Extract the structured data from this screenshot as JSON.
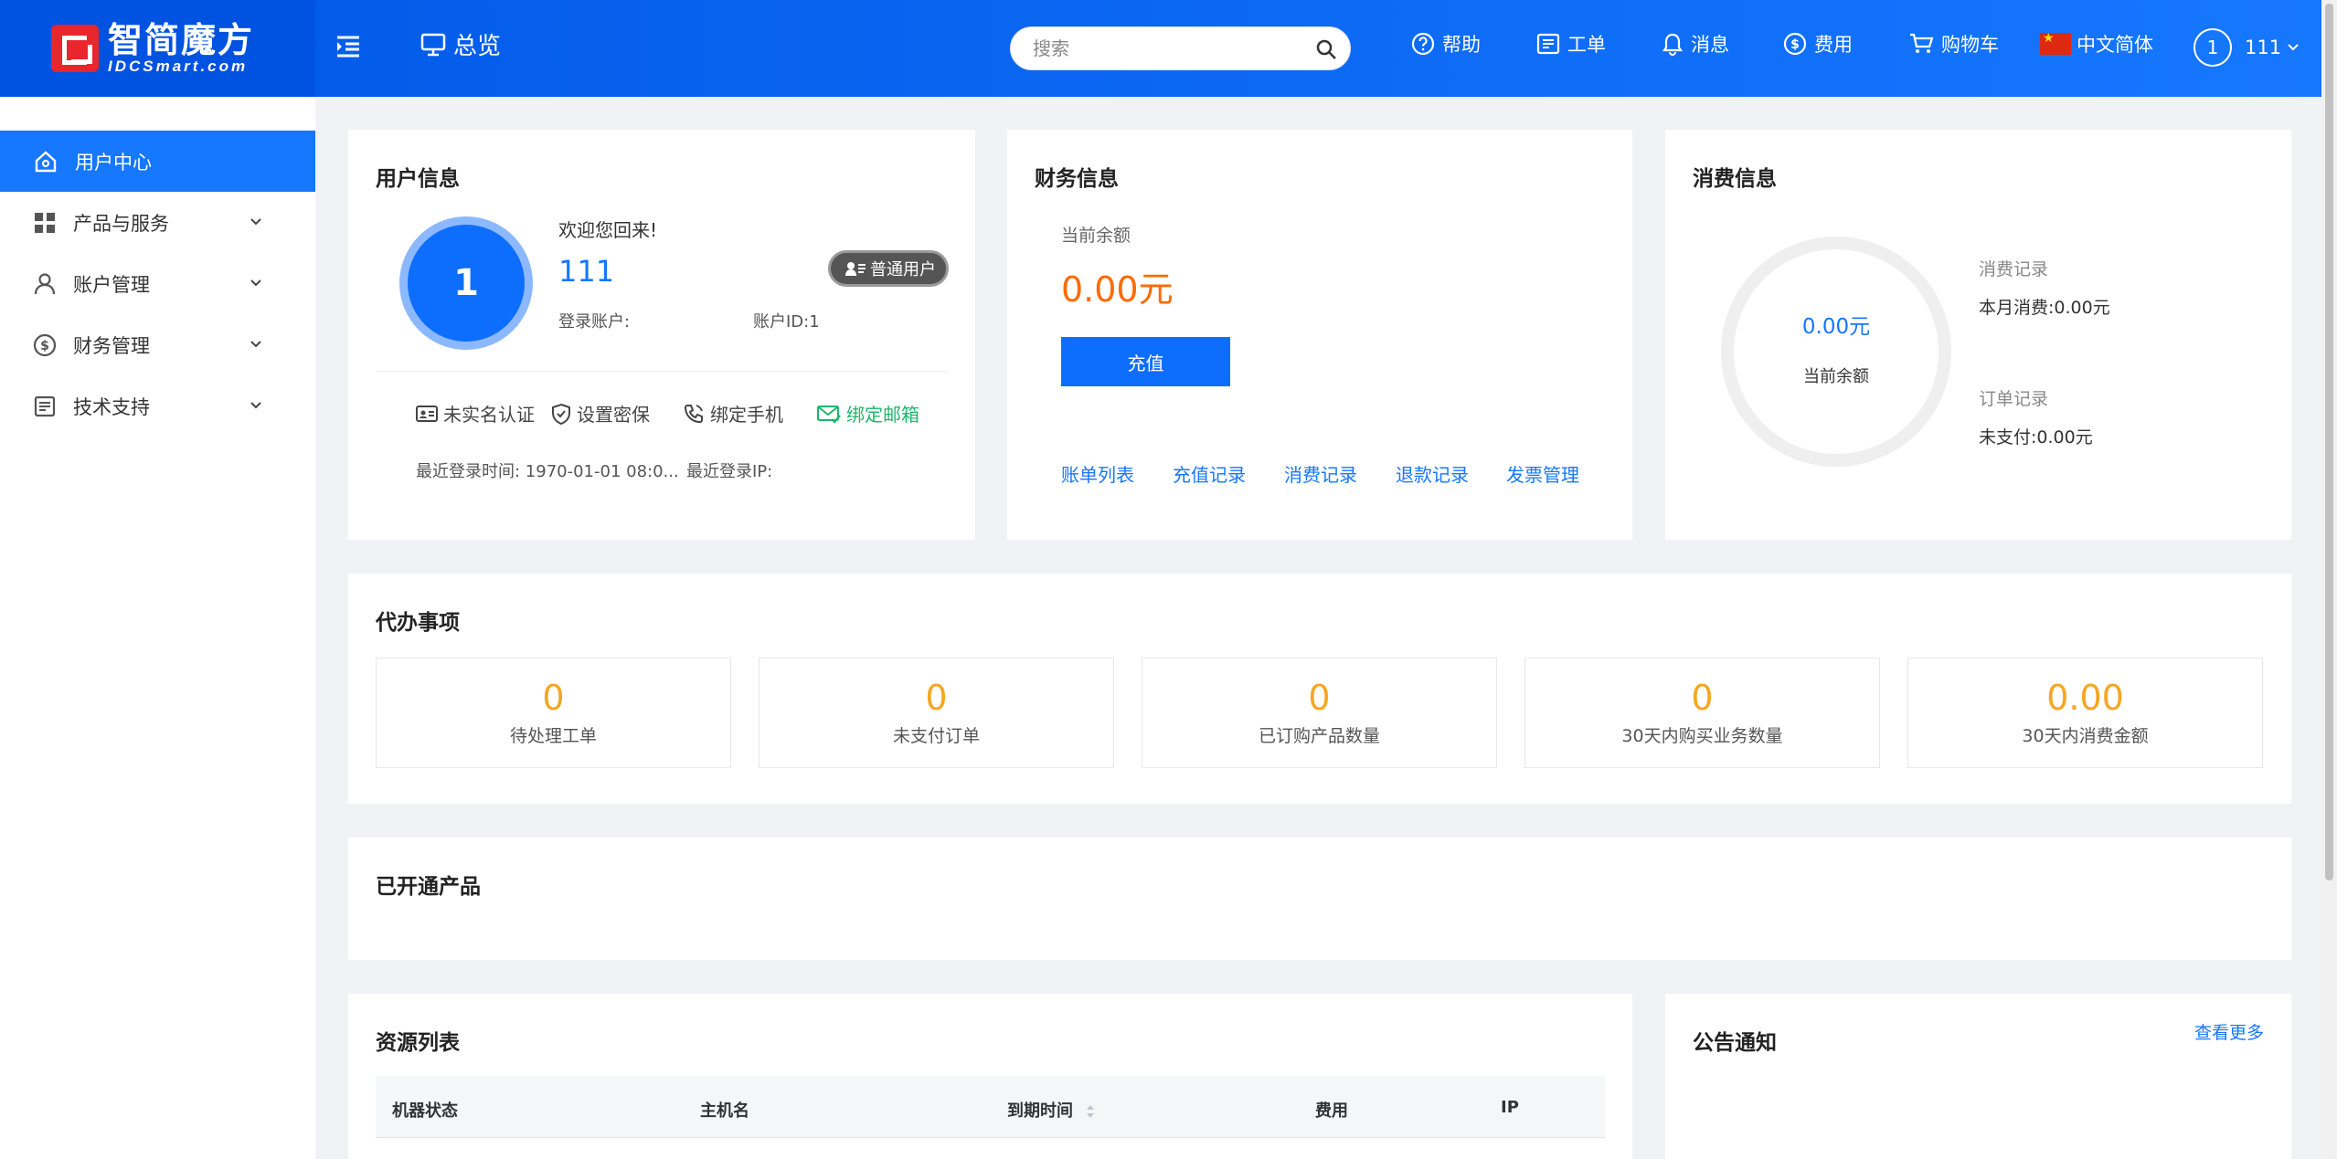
{
  "header": {
    "logo_cn": "智简魔方",
    "logo_en": "IDCSmart.com",
    "overview": "总览",
    "search_placeholder": "搜索",
    "nav": {
      "help": "帮助",
      "ticket": "工单",
      "message": "消息",
      "fee": "费用",
      "cart": "购物车",
      "language": "中文简体",
      "avatar": "1",
      "user": "111"
    }
  },
  "sidebar": {
    "items": [
      {
        "label": "用户中心"
      },
      {
        "label": "产品与服务"
      },
      {
        "label": "账户管理"
      },
      {
        "label": "财务管理"
      },
      {
        "label": "技术支持"
      }
    ]
  },
  "user_card": {
    "title": "用户信息",
    "avatar": "1",
    "welcome": "欢迎您回来!",
    "username": "111",
    "badge": "普通用户",
    "login_account": "登录账户:",
    "account_id": "账户ID:1",
    "verify": {
      "realname": "未实名认证",
      "security": "设置密保",
      "phone": "绑定手机",
      "email": "绑定邮箱"
    },
    "last_login_time": "最近登录时间:  1970-01-01 08:0...",
    "last_login_ip": "最近登录IP:"
  },
  "finance_card": {
    "title": "财务信息",
    "balance_label": "当前余额",
    "balance": "0.00元",
    "recharge": "充值",
    "links": [
      "账单列表",
      "充值记录",
      "消费记录",
      "退款记录",
      "发票管理"
    ]
  },
  "consume_card": {
    "title": "消费信息",
    "ring_amount": "0.00元",
    "ring_label": "当前余额",
    "consume_record": "消费记录",
    "month_consume": "本月消费:0.00元",
    "order_record": "订单记录",
    "unpaid": "未支付:0.00元"
  },
  "todo_card": {
    "title": "代办事项",
    "items": [
      {
        "value": "0",
        "label": "待处理工单"
      },
      {
        "value": "0",
        "label": "未支付订单"
      },
      {
        "value": "0",
        "label": "已订购产品数量"
      },
      {
        "value": "0",
        "label": "30天内购买业务数量"
      },
      {
        "value": "0.00",
        "label": "30天内消费金额"
      }
    ]
  },
  "products_card": {
    "title": "已开通产品"
  },
  "resource_card": {
    "title": "资源列表",
    "columns": [
      "机器状态",
      "主机名",
      "到期时间",
      "费用",
      "IP"
    ]
  },
  "notice_card": {
    "title": "公告通知",
    "more": "查看更多"
  },
  "colors": {
    "primary": "#1677ff",
    "amount_orange": "#ff6a00",
    "todo_orange": "#f6a623",
    "green": "#1cb86b"
  }
}
